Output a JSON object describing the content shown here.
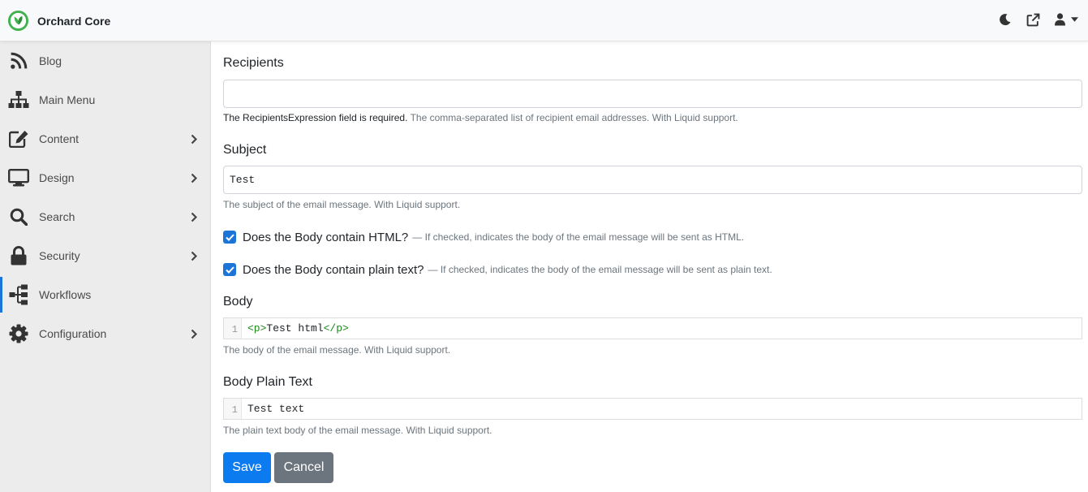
{
  "app": {
    "title": "Orchard Core",
    "brand_color": "#3fb24d"
  },
  "topbar": {
    "icons": [
      "moon-icon",
      "external-link-icon",
      "user-icon",
      "caret-down-icon"
    ]
  },
  "sidebar": {
    "items": [
      {
        "label": "Blog",
        "icon": "rss-icon",
        "has_children": false,
        "active": false
      },
      {
        "label": "Main Menu",
        "icon": "sitemap-icon",
        "has_children": false,
        "active": false
      },
      {
        "label": "Content",
        "icon": "edit-icon",
        "has_children": true,
        "active": false
      },
      {
        "label": "Design",
        "icon": "desktop-icon",
        "has_children": true,
        "active": false
      },
      {
        "label": "Search",
        "icon": "search-icon",
        "has_children": true,
        "active": false
      },
      {
        "label": "Security",
        "icon": "lock-icon",
        "has_children": true,
        "active": false
      },
      {
        "label": "Workflows",
        "icon": "workflow-icon",
        "has_children": false,
        "active": true
      },
      {
        "label": "Configuration",
        "icon": "gear-icon",
        "has_children": true,
        "active": false
      }
    ],
    "active_color": "#1b74d8"
  },
  "form": {
    "recipients": {
      "label": "Recipients",
      "value": "",
      "error": "The RecipientsExpression field is required.",
      "help": "The comma-separated list of recipient email addresses. With Liquid support."
    },
    "subject": {
      "label": "Subject",
      "value": "Test",
      "help": "The subject of the email message. With Liquid support."
    },
    "is_html": {
      "checked": true,
      "label": "Does the Body contain HTML?",
      "hint": "— If checked, indicates the body of the email message will be sent as HTML."
    },
    "is_plain": {
      "checked": true,
      "label": "Does the Body contain plain text?",
      "hint": "— If checked, indicates the body of the email message will be sent as plain text."
    },
    "body": {
      "label": "Body",
      "line_number": "1",
      "code_open_tag": "<p>",
      "code_text": "Test html",
      "code_close_tag": "</p>",
      "help": "The body of the email message. With Liquid support."
    },
    "body_plain": {
      "label": "Body Plain Text",
      "line_number": "1",
      "code_text": "Test text",
      "help": "The plain text body of the email message. With Liquid support."
    },
    "buttons": {
      "save": "Save",
      "cancel": "Cancel"
    }
  },
  "colors": {
    "primary": "#0d7bf0",
    "secondary": "#6c757d",
    "checkbox": "#1b74d8"
  }
}
